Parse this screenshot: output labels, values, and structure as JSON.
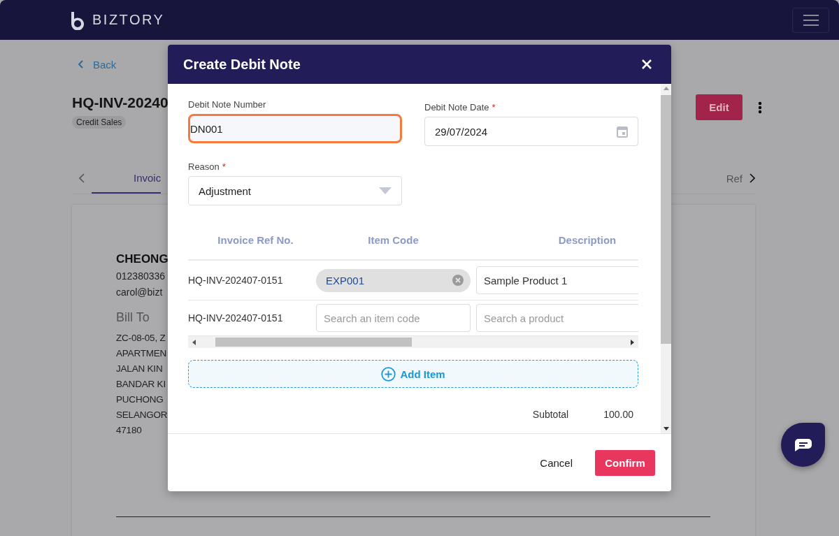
{
  "app_bar": {
    "brand": "BIZTORY"
  },
  "page": {
    "back": "Back",
    "title": "HQ-INV-20240",
    "badge": "Credit Sales",
    "edit_button": "Edit",
    "tabs": [
      {
        "label": "Invoic",
        "selected": true
      },
      {
        "label": "Ref",
        "selected": false
      }
    ],
    "document": {
      "company": "CHEONG",
      "phone": "012380336",
      "email": "carol@bizt",
      "bill_to_heading": "Bill To",
      "address_lines": [
        "ZC-08-05, Z",
        "APARTMEN",
        "JALAN KIN",
        "BANDAR KI",
        "PUCHONG",
        "SELANGOR",
        "47180"
      ]
    }
  },
  "dialog": {
    "title": "Create Debit Note",
    "fields": [
      {
        "kind": "text",
        "label": "Debit Note Number",
        "value": "DN001",
        "focused": true
      },
      {
        "kind": "date",
        "label": "Debit Note Date",
        "required_mark": "*",
        "value": "29/07/2024",
        "focused": false
      },
      {
        "kind": "select",
        "label": "Reason",
        "required_mark": "*",
        "value": "Adjustment",
        "focused": false
      }
    ],
    "table": {
      "columns": [
        "Invoice Ref No.",
        "Item Code",
        "Description"
      ],
      "rows": [
        {
          "invoice_ref": "HQ-INV-202407-0151",
          "item_code": {
            "kind": "chip",
            "value": "EXP001"
          },
          "description": {
            "value": "Sample Product 1"
          }
        },
        {
          "invoice_ref": "HQ-INV-202407-0151",
          "item_code": {
            "kind": "search",
            "placeholder": "Search an item code"
          },
          "description": {
            "placeholder": "Search a product"
          }
        }
      ]
    },
    "add_button": "Add Item",
    "totals": [
      {
        "label": "Subtotal",
        "value": "100.00"
      }
    ],
    "buttons": [
      {
        "kind": "text",
        "label": "Cancel"
      },
      {
        "kind": "primary",
        "label": "Confirm"
      }
    ]
  }
}
